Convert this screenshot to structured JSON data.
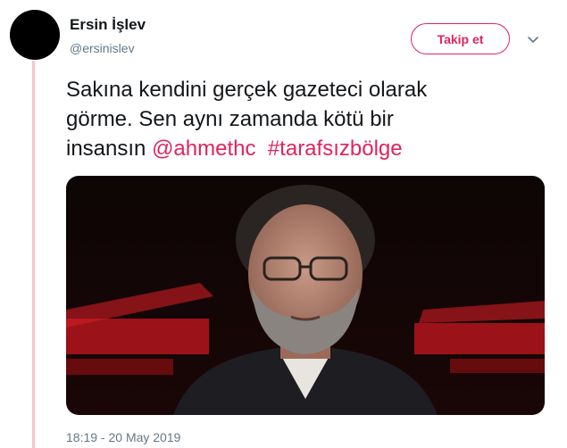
{
  "author": {
    "name": "Ersin İşlev",
    "handle": "@ersinislev"
  },
  "follow_button": {
    "label": "Takip et"
  },
  "menu": {
    "icon": "chevron-down-icon"
  },
  "tweet": {
    "text_line1": "Sakına kendini gerçek gazeteci olarak",
    "text_line2": "görme. Sen aynı zamanda kötü bir",
    "text_line3": "insansın",
    "mention": "@ahmethc",
    "hashtag": "#tarafsızbölge"
  },
  "media": {
    "icon": "photo"
  },
  "timestamp": "18:19 - 20 May 2019",
  "colors": {
    "accent": "#e0245e",
    "thread_line": "#f5c6cf",
    "secondary_text": "#657786",
    "primary_text": "#14171a"
  }
}
